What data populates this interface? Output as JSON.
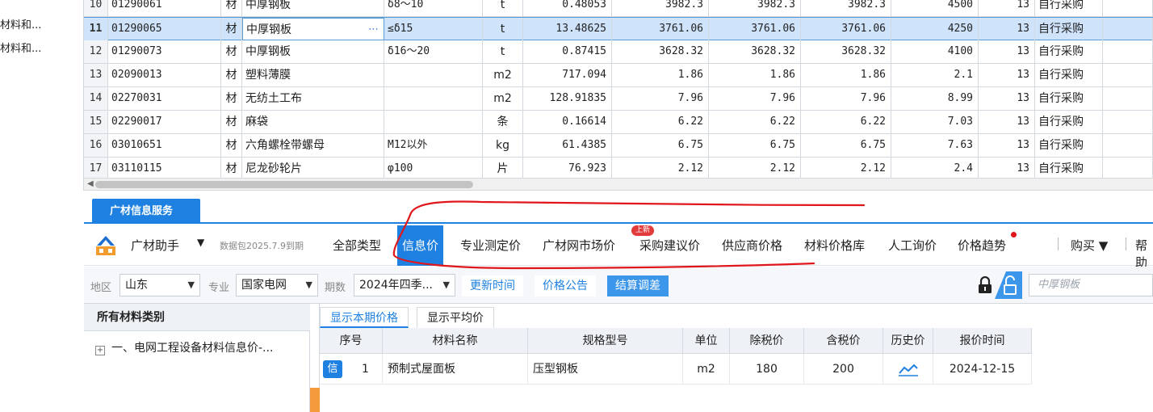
{
  "left_tree": [
    "材料和...",
    "材料和..."
  ],
  "grid_rows": [
    {
      "num": "10",
      "code": "01290061",
      "type": "材",
      "name": "中厚钢板",
      "spec": "δ8～10",
      "unit": "t",
      "qty": "0.48053",
      "p1": "3982.3",
      "p2": "3982.3",
      "p3": "3982.3",
      "p4": "4500",
      "tax": "13",
      "source": "自行采购"
    },
    {
      "num": "11",
      "code": "01290065",
      "type": "材",
      "name": "中厚钢板",
      "spec": "≤δ15",
      "unit": "t",
      "qty": "13.48625",
      "p1": "3761.06",
      "p2": "3761.06",
      "p3": "3761.06",
      "p4": "4250",
      "tax": "13",
      "source": "自行采购"
    },
    {
      "num": "12",
      "code": "01290073",
      "type": "材",
      "name": "中厚钢板",
      "spec": "δ16～20",
      "unit": "t",
      "qty": "0.87415",
      "p1": "3628.32",
      "p2": "3628.32",
      "p3": "3628.32",
      "p4": "4100",
      "tax": "13",
      "source": "自行采购"
    },
    {
      "num": "13",
      "code": "02090013",
      "type": "材",
      "name": "塑料薄膜",
      "spec": "",
      "unit": "m2",
      "qty": "717.094",
      "p1": "1.86",
      "p2": "1.86",
      "p3": "1.86",
      "p4": "2.1",
      "tax": "13",
      "source": "自行采购"
    },
    {
      "num": "14",
      "code": "02270031",
      "type": "材",
      "name": "无纺土工布",
      "spec": "",
      "unit": "m2",
      "qty": "128.91835",
      "p1": "7.96",
      "p2": "7.96",
      "p3": "7.96",
      "p4": "8.99",
      "tax": "13",
      "source": "自行采购"
    },
    {
      "num": "15",
      "code": "02290017",
      "type": "材",
      "name": "麻袋",
      "spec": "",
      "unit": "条",
      "qty": "0.16614",
      "p1": "6.22",
      "p2": "6.22",
      "p3": "6.22",
      "p4": "7.03",
      "tax": "13",
      "source": "自行采购"
    },
    {
      "num": "16",
      "code": "03010651",
      "type": "材",
      "name": "六角螺栓带螺母",
      "spec": "M12以外",
      "unit": "kg",
      "qty": "61.4385",
      "p1": "6.75",
      "p2": "6.75",
      "p3": "6.75",
      "p4": "7.63",
      "tax": "13",
      "source": "自行采购"
    },
    {
      "num": "17",
      "code": "03110115",
      "type": "材",
      "name": "尼龙砂轮片",
      "spec": "φ100",
      "unit": "片",
      "qty": "76.923",
      "p1": "2.12",
      "p2": "2.12",
      "p3": "2.12",
      "p4": "2.4",
      "tax": "13",
      "source": "自行采购"
    }
  ],
  "selected_row": "11",
  "service": {
    "tab_label": "广材信息服务",
    "brand": "广材助手",
    "brand_caret": "▼",
    "data_pack": "数据包2025.7.9到期",
    "nav_tabs": [
      "全部类型",
      "信息价",
      "专业测定价",
      "广材网市场价",
      "采购建议价",
      "供应商价格",
      "材料价格库",
      "人工询价",
      "价格趋势"
    ],
    "active_tab": "信息价",
    "new_badge": "上新",
    "buy": "购买 ▼",
    "help": "帮助"
  },
  "filters": {
    "region_label": "地区",
    "region_value": "山东",
    "major_label": "专业",
    "major_value": "国家电网",
    "period_label": "期数",
    "period_value": "2024年四季...",
    "btn_update_time": "更新时间",
    "btn_price_notice": "价格公告",
    "btn_settlement": "结算调差",
    "search_placeholder": "中厚钢板"
  },
  "category_panel": {
    "header": "所有材料类别",
    "item": "一、电网工程设备材料信息价-..."
  },
  "price_tabs": [
    "显示本期价格",
    "显示平均价"
  ],
  "price_table": {
    "headers": [
      "序号",
      "材料名称",
      "规格型号",
      "单位",
      "除税价",
      "含税价",
      "历史价",
      "报价时间"
    ],
    "rows": [
      {
        "badge": "信",
        "num": "1",
        "name": "预制式屋面板",
        "spec": "压型钢板",
        "unit": "m2",
        "pre_tax": "180",
        "with_tax": "200",
        "date": "2024-12-15"
      }
    ]
  },
  "colors": {
    "accent": "#1e80e0",
    "selected_row": "#cfe3fb",
    "annotation": "#e0161b",
    "badge_red": "#e23b3b"
  }
}
